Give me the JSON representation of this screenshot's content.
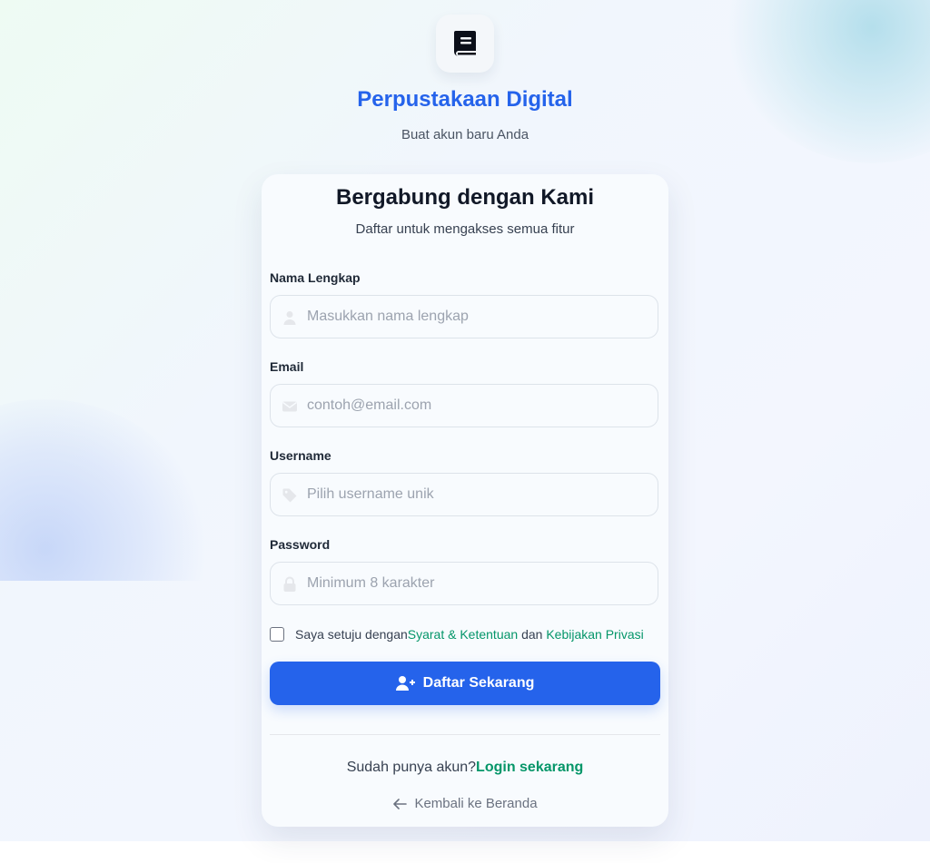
{
  "brand": {
    "title": "Perpustakaan Digital",
    "subtitle": "Buat akun baru Anda",
    "logo_icon": "book-icon"
  },
  "card": {
    "title": "Bergabung dengan Kami",
    "subtitle": "Daftar untuk mengakses semua fitur"
  },
  "form": {
    "full_name": {
      "label": "Nama Lengkap",
      "placeholder": "Masukkan nama lengkap",
      "value": "",
      "icon": "user-icon"
    },
    "email": {
      "label": "Email",
      "placeholder": "contoh@email.com",
      "value": "",
      "icon": "envelope-icon"
    },
    "username": {
      "label": "Username",
      "placeholder": "Pilih username unik",
      "value": "",
      "icon": "tag-icon"
    },
    "password": {
      "label": "Password",
      "placeholder": "Minimum 8 karakter",
      "value": "",
      "icon": "lock-icon"
    },
    "terms": {
      "checked": false,
      "prefix": "Saya setuju dengan",
      "terms_link": "Syarat & Ketentuan",
      "conjunction": "dan",
      "privacy_link": "Kebijakan Privasi"
    },
    "submit_label": "Daftar Sekarang",
    "submit_icon": "user-plus-icon"
  },
  "footer": {
    "login_prompt": "Sudah punya akun?",
    "login_link": "Login sekarang",
    "back_label": "Kembali ke Beranda",
    "back_icon": "arrow-left-icon"
  },
  "colors": {
    "primary": "#2563eb",
    "link": "#059669",
    "heading": "#111827",
    "placeholder": "#9ca3af"
  }
}
